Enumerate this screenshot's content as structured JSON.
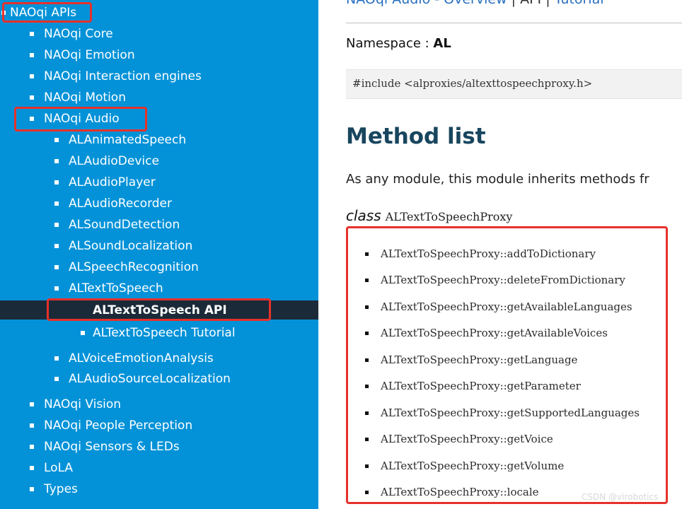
{
  "sidebar": {
    "root": "NAOqi APIs",
    "core": "NAOqi Core",
    "emotion": "NAOqi Emotion",
    "interaction": "NAOqi Interaction engines",
    "motion": "NAOqi Motion",
    "audio": "NAOqi Audio",
    "audio_items": [
      "ALAnimatedSpeech",
      "ALAudioDevice",
      "ALAudioPlayer",
      "ALAudioRecorder",
      "ALSoundDetection",
      "ALSoundLocalization",
      "ALSpeechRecognition",
      "ALTextToSpeech"
    ],
    "tts_api": "ALTextToSpeech API",
    "tts_tutorial": "ALTextToSpeech Tutorial",
    "audio_items_after": [
      "ALVoiceEmotionAnalysis",
      "ALAudioSourceLocalization"
    ],
    "tail_items": [
      "NAOqi Vision",
      "NAOqi People Perception",
      "NAOqi Sensors & LEDs",
      "LoLA",
      "Types"
    ]
  },
  "content": {
    "top_links": {
      "overview": "NAOqi Audio - Overview",
      "sep1": " | ",
      "api": "API",
      "sep2": " | ",
      "tutorial": "Tutorial"
    },
    "namespace_label": "Namespace : ",
    "namespace_value": "AL",
    "include_code": "#include <alproxies/altexttospeechproxy.h>",
    "heading": "Method list",
    "intro": "As any module, this module inherits methods fr",
    "class_keyword": "class",
    "class_name": "ALTextToSpeechProxy",
    "methods": [
      "ALTextToSpeechProxy::addToDictionary",
      "ALTextToSpeechProxy::deleteFromDictionary",
      "ALTextToSpeechProxy::getAvailableLanguages",
      "ALTextToSpeechProxy::getAvailableVoices",
      "ALTextToSpeechProxy::getLanguage",
      "ALTextToSpeechProxy::getParameter",
      "ALTextToSpeechProxy::getSupportedLanguages",
      "ALTextToSpeechProxy::getVoice",
      "ALTextToSpeechProxy::getVolume",
      "ALTextToSpeechProxy::locale"
    ]
  },
  "watermark": "CSDN @virobotics",
  "colors": {
    "sidebar_bg": "#0392d8",
    "active_bg": "#1b2a38",
    "highlight": "#e6312b",
    "heading": "#18465e"
  }
}
